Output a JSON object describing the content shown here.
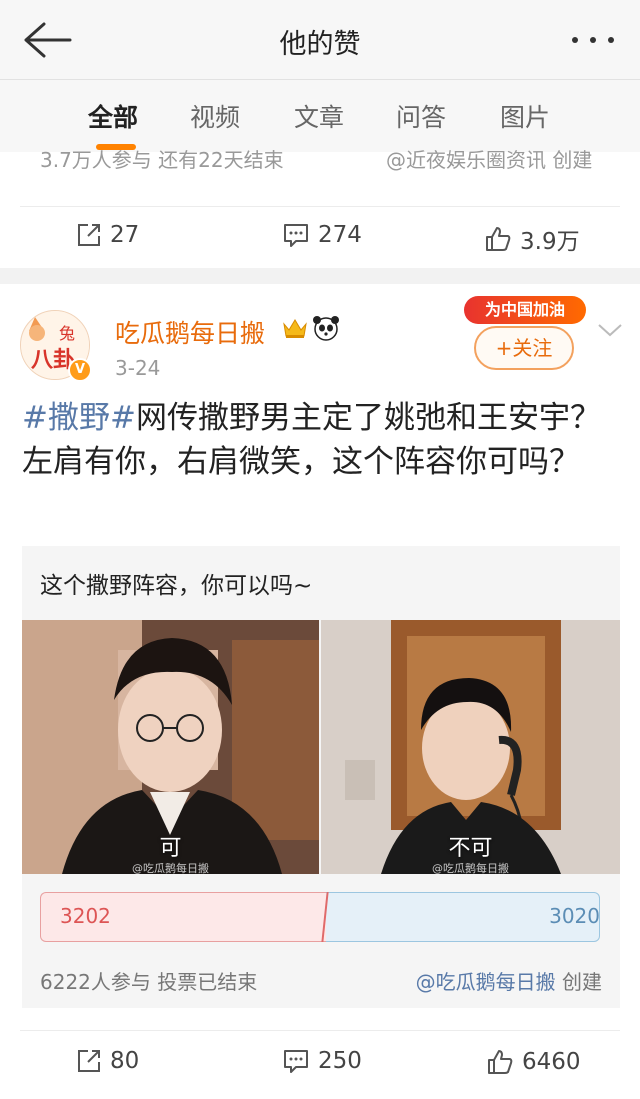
{
  "header": {
    "title": "他的赞"
  },
  "tabs": [
    {
      "label": "全部",
      "active": true
    },
    {
      "label": "视频"
    },
    {
      "label": "文章"
    },
    {
      "label": "问答"
    },
    {
      "label": "图片"
    }
  ],
  "previous_post": {
    "cut_left": "3.7万人参与 还有22天结束",
    "cut_right": "@近夜娱乐圈资讯 创建",
    "reposts": "27",
    "comments": "274",
    "likes": "3.9万"
  },
  "post": {
    "avatar_text": "兔 八卦",
    "username": "吃瓜鹅每日搬",
    "date": "3-24",
    "banner": "为中国加油",
    "follow_label": "+关注",
    "hashtag": "#撒野#",
    "text": "网传撒野男主定了姚弛和王安宇？左肩有你，右肩微笑，这个阵容你可吗？",
    "vote": {
      "title": "这个撒野阵容，你可以吗~",
      "option_left": "可",
      "option_right": "不可",
      "watermark": "@吃瓜鹅每日搬",
      "count_left": "3202",
      "count_right": "3020",
      "meta": "6222人参与  投票已结束",
      "creator": "@吃瓜鹅每日搬",
      "creator_suffix": " 创建"
    },
    "reposts": "80",
    "comments": "250",
    "likes": "6460"
  },
  "colors": {
    "accent": "#ff8200",
    "username": "#e86b0c",
    "link": "#5879a8"
  }
}
